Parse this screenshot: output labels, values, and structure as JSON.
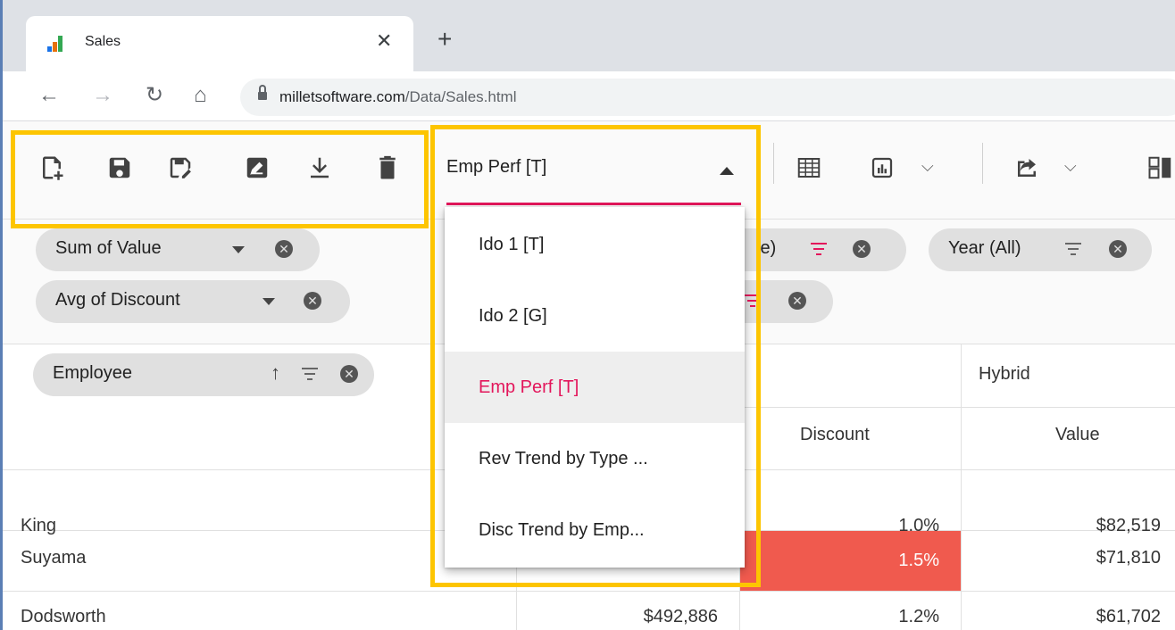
{
  "browser": {
    "tab_title": "Sales",
    "url_host": "milletsoftware.com",
    "url_path": "/Data/Sales.html"
  },
  "toolbar": {
    "report_selected": "Emp Perf [T]",
    "highlight_color": "#fdc500",
    "accent_color": "#e3165b"
  },
  "report_menu": {
    "items": [
      {
        "label": "Ido 1 [T]"
      },
      {
        "label": "Ido 2 [G]"
      },
      {
        "label": "Emp Perf [T]"
      },
      {
        "label": "Rev Trend by Type ..."
      },
      {
        "label": "Disc Trend by Emp..."
      }
    ],
    "selected_index": 2
  },
  "pivot": {
    "value_pills": [
      "Sum of Value",
      "Avg of Discount"
    ],
    "column_pill_partial": "le)",
    "filter_pill": "Year (All)",
    "row_pill": "Employee",
    "col_headers": {
      "hybrid": "Hybrid",
      "discount": "Discount",
      "value": "Value"
    },
    "rows": [
      {
        "name": "King",
        "col2": "",
        "discount": "1.0%",
        "value": "$82,519"
      },
      {
        "name": "Suyama",
        "col2": "",
        "discount": "1.5%",
        "value": "$71,810"
      },
      {
        "name": "Dodsworth",
        "col2": "$492,886",
        "discount": "1.2%",
        "value": "$61,702"
      }
    ],
    "highlight_cell_color": "#f05a4e"
  }
}
